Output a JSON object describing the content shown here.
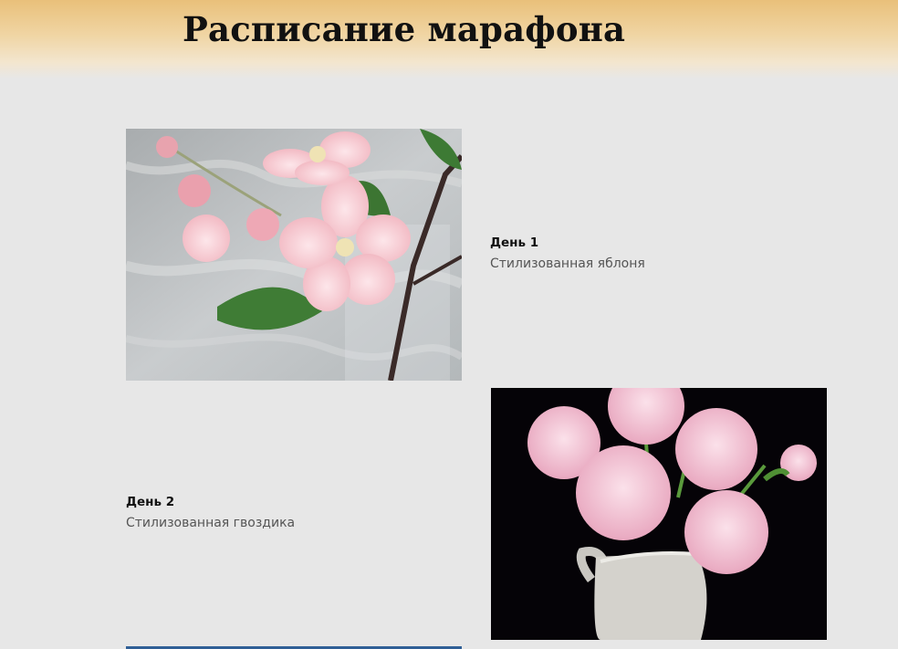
{
  "header": {
    "title": "Расписание марафона"
  },
  "days": [
    {
      "title": "День 1",
      "description": "Стилизованная яблоня"
    },
    {
      "title": "День 2",
      "description": "Стилизованная гвоздика"
    }
  ],
  "colors": {
    "page_background": "#e7e7e7",
    "header_gradient_top": "#e9c07a"
  }
}
